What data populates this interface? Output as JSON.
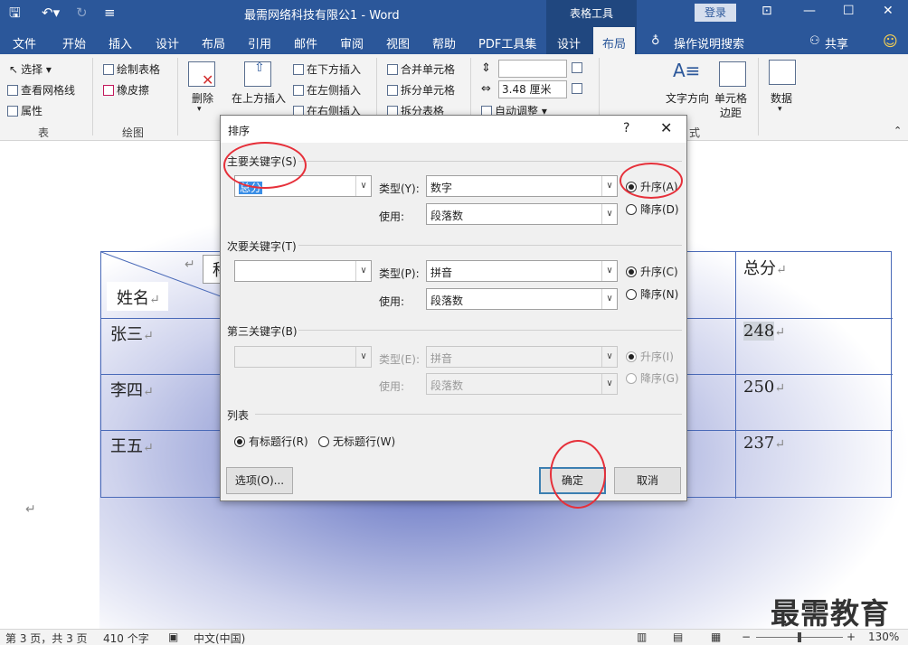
{
  "window": {
    "title": "最需网络科技有限公1 - Word",
    "context_tools": "表格工具",
    "login": "登录"
  },
  "tabs": [
    "文件",
    "开始",
    "插入",
    "设计",
    "布局",
    "引用",
    "邮件",
    "审阅",
    "视图",
    "帮助",
    "PDF工具集",
    "设计",
    "布局",
    "操作说明搜索",
    "共享"
  ],
  "ribbon": {
    "select": "选择",
    "view_gridlines": "查看网格线",
    "properties": "属性",
    "group_table": "表",
    "draw_table": "绘制表格",
    "eraser": "橡皮擦",
    "group_draw": "绘图",
    "delete": "删除",
    "insert_above": "在上方插入",
    "insert_below": "在下方插入",
    "insert_left": "在左侧插入",
    "insert_right": "在右侧插入",
    "merge_cells": "合并单元格",
    "split_cells": "拆分单元格",
    "split_table": "拆分表格",
    "height_value": "",
    "width_value": "3.48 厘米",
    "autofit": "自动调整",
    "text_direction": "文字方向",
    "cell_margins_1": "单元格",
    "cell_margins_2": "边距",
    "data": "数据",
    "group_align_partial": "式"
  },
  "table": {
    "header_name": "姓名",
    "header_partial": "科",
    "header_total": "总分",
    "rows": [
      {
        "name": "张三",
        "total": "248"
      },
      {
        "name": "李四",
        "total": "250"
      },
      {
        "name": "王五",
        "total": "237"
      }
    ],
    "return_mark": "↵"
  },
  "watermark": "最需教育",
  "statusbar": {
    "page": "第 3 页，共 3 页",
    "words": "410 个字",
    "language": "中文(中国)",
    "zoom": "130%"
  },
  "dialog": {
    "title": "排序",
    "help": "?",
    "close": "✕",
    "primary_key": "主要关键字(S)",
    "primary_value": "总分",
    "type_label_y": "类型(Y):",
    "primary_type": "数字",
    "use_label": "使用:",
    "primary_use": "段落数",
    "asc_a": "升序(A)",
    "desc_d": "降序(D)",
    "secondary_key": "次要关键字(T)",
    "secondary_value": "",
    "type_label_p": "类型(P):",
    "secondary_type": "拼音",
    "secondary_use": "段落数",
    "asc_c": "升序(C)",
    "desc_n": "降序(N)",
    "third_key": "第三关键字(B)",
    "third_value": "",
    "type_label_e": "类型(E):",
    "third_type": "拼音",
    "third_use": "段落数",
    "asc_i": "升序(I)",
    "desc_g": "降序(G)",
    "list_section": "列表",
    "has_header": "有标题行(R)",
    "no_header": "无标题行(W)",
    "options": "选项(O)...",
    "ok": "确定",
    "cancel": "取消"
  },
  "colors": {
    "accent": "#2b579a",
    "annotation": "#e6303a"
  }
}
